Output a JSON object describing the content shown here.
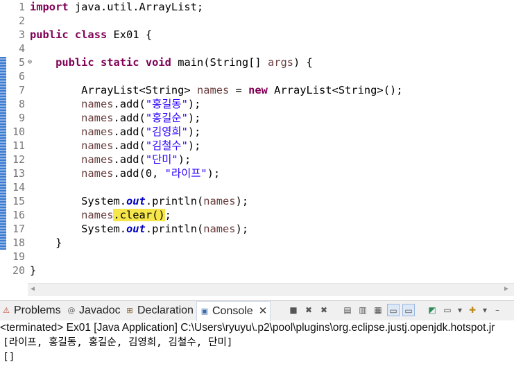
{
  "editor": {
    "line_numbers": [
      "1",
      "2",
      "3",
      "4",
      "5",
      "6",
      "7",
      "8",
      "9",
      "10",
      "11",
      "12",
      "13",
      "14",
      "15",
      "16",
      "17",
      "18",
      "19",
      "20"
    ],
    "lines": {
      "l1_kw": "import",
      "l1_rest": " java.util.ArrayList;",
      "l3_kw1": "public",
      "l3_kw2": "class",
      "l3_rest": " Ex01 {",
      "l5_kw1": "public",
      "l5_kw2": "static",
      "l5_kw3": "void",
      "l5_mid": " main(String[] ",
      "l5_var": "args",
      "l5_end": ") {",
      "l7_a": "ArrayList<String> ",
      "l7_var": "names",
      "l7_b": " = ",
      "l7_kw": "new",
      "l7_c": " ArrayList<String>();",
      "names": "names",
      "add": ".add(",
      "l8_str": "\"홍길동\"",
      "l9_str": "\"홍길순\"",
      "l10_str": "\"김영희\"",
      "l11_str": "\"김철수\"",
      "l12_str": "\"단미\"",
      "close": ");",
      "l13_mid": "0, ",
      "l13_str": "\"라이프\"",
      "system": "System.",
      "out": "out",
      "println": ".println(",
      "l16_clear": ".clear()",
      "l16_semi": ";",
      "l18": "}",
      "l20": "}"
    }
  },
  "tabs": [
    {
      "label": "Problems",
      "icon": "problems-icon"
    },
    {
      "label": "Javadoc",
      "icon": "javadoc-icon"
    },
    {
      "label": "Declaration",
      "icon": "declaration-icon"
    },
    {
      "label": "Console",
      "icon": "console-icon"
    }
  ],
  "console": {
    "status": "<terminated> Ex01 [Java Application] C:\\Users\\ryuyu\\.p2\\pool\\plugins\\org.eclipse.justj.openjdk.hotspot.jr",
    "output": [
      "[라이프, 홍길동, 홍길순, 김영희, 김철수, 단미]",
      "[]"
    ]
  },
  "colors": {
    "keyword": "#7f0055",
    "string": "#2a00ff",
    "field": "#0000c0",
    "highlight": "#f6e64a"
  }
}
